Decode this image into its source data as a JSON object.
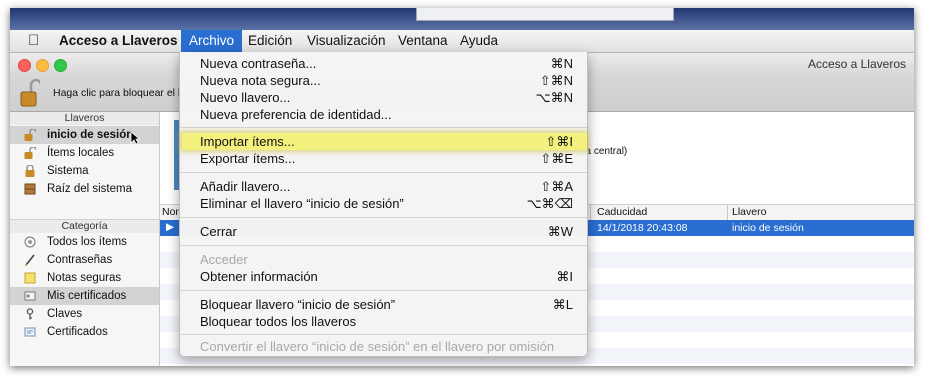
{
  "menubar": {
    "apple_icon": "apple-logo",
    "app_name": "Acceso a Llaveros",
    "items": [
      "Archivo",
      "Edición",
      "Visualización",
      "Ventana",
      "Ayuda"
    ],
    "active": "Archivo"
  },
  "window": {
    "title": "Acceso a Llaveros",
    "lock_text": "Haga clic para bloquear el l"
  },
  "sidebar": {
    "keychains_header": "Llaveros",
    "keychains": [
      {
        "label": "inicio de sesión",
        "icon": "unlocked-padlock-icon",
        "selected": true
      },
      {
        "label": "Ítems locales",
        "icon": "unlocked-padlock-icon",
        "selected": false
      },
      {
        "label": "Sistema",
        "icon": "locked-padlock-icon",
        "selected": false
      },
      {
        "label": "Raíz del sistema",
        "icon": "cabinet-icon",
        "selected": false
      }
    ],
    "category_header": "Categoría",
    "categories": [
      {
        "label": "Todos los ítems",
        "icon": "all-items-icon",
        "selected": false
      },
      {
        "label": "Contraseñas",
        "icon": "pencil-icon",
        "selected": false
      },
      {
        "label": "Notas seguras",
        "icon": "note-icon",
        "selected": false
      },
      {
        "label": "Mis certificados",
        "icon": "my-certificate-icon",
        "selected": true
      },
      {
        "label": "Claves",
        "icon": "key-icon",
        "selected": false
      },
      {
        "label": "Certificados",
        "icon": "certificate-icon",
        "selected": false
      }
    ]
  },
  "main": {
    "cert_partial_text": "pa central)",
    "columns": [
      "Nom",
      "Caducidad",
      "Llavero"
    ],
    "selected_row": {
      "expiry": "14/1/2018 20:43:08",
      "keychain": "inicio de sesión"
    }
  },
  "file_menu": {
    "items": [
      {
        "label": "Nueva contraseña...",
        "shortcut": "⌘N",
        "disabled": false
      },
      {
        "label": "Nueva nota segura...",
        "shortcut": "⇧⌘N",
        "disabled": false
      },
      {
        "label": "Nuevo llavero...",
        "shortcut": "⌥⌘N",
        "disabled": false
      },
      {
        "label": "Nueva preferencia de identidad...",
        "shortcut": "",
        "disabled": false
      },
      {
        "label": "Importar ítems...",
        "shortcut": "⇧⌘I",
        "disabled": false,
        "highlighted": true
      },
      {
        "label": "Exportar ítems...",
        "shortcut": "⇧⌘E",
        "disabled": false
      },
      {
        "label": "Añadir llavero...",
        "shortcut": "⇧⌘A",
        "disabled": false
      },
      {
        "label": "Eliminar el llavero “inicio de sesión”",
        "shortcut": "⌥⌘⌫",
        "disabled": false
      },
      {
        "label": "Cerrar",
        "shortcut": "⌘W",
        "disabled": false
      },
      {
        "label": "Acceder",
        "shortcut": "",
        "disabled": true
      },
      {
        "label": "Obtener información",
        "shortcut": "⌘I",
        "disabled": false
      },
      {
        "label": "Bloquear llavero “inicio de sesión”",
        "shortcut": "⌘L",
        "disabled": false
      },
      {
        "label": "Bloquear todos los llaveros",
        "shortcut": "",
        "disabled": false
      },
      {
        "label": "Convertir el llavero “inicio de sesión” en el llavero por omisión",
        "shortcut": "",
        "disabled": true
      }
    ]
  },
  "colors": {
    "selection": "#2a6ed1",
    "highlight": "#f3f07e",
    "close": "#fc605c",
    "minimize": "#fdbc40",
    "zoom": "#34c84a"
  }
}
